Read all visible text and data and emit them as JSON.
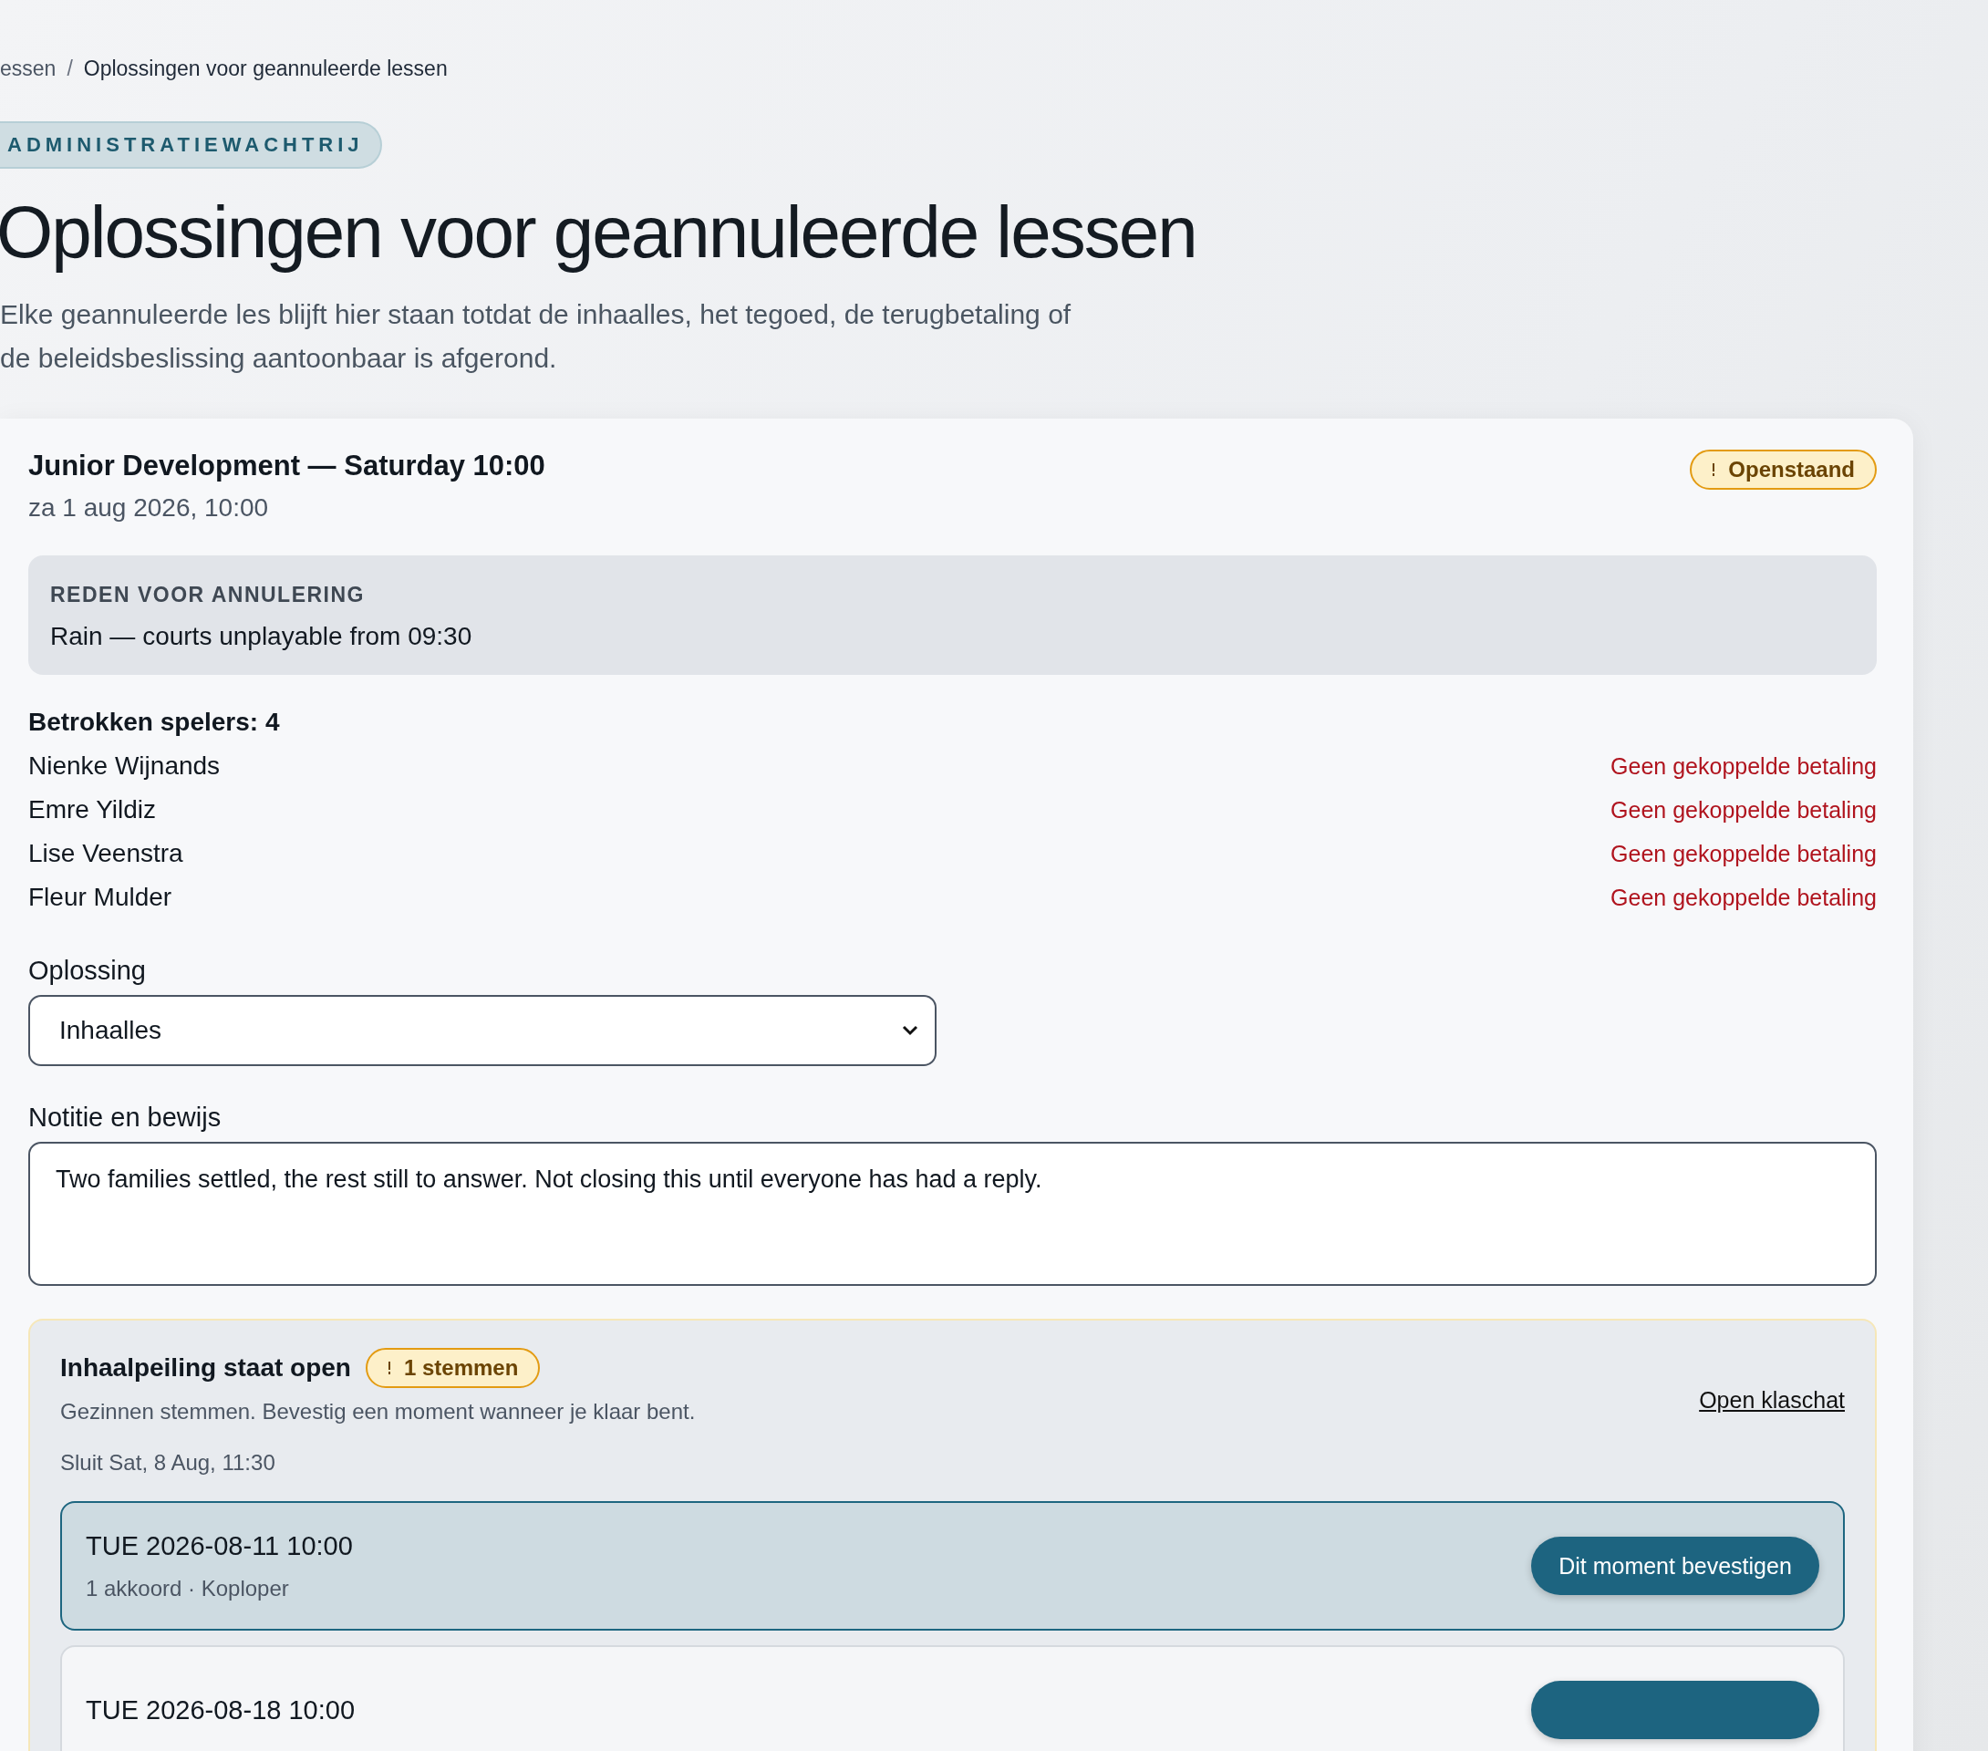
{
  "breadcrumb": {
    "parent": "essen",
    "separator": "/",
    "current": "Oplossingen voor geannuleerde lessen"
  },
  "eyebrow": "ADMINISTRATIEWACHTRIJ",
  "title": "Oplossingen voor geannuleerde lessen",
  "description": [
    "Elke geannuleerde les blijft hier staan totdat de inhaalles, het tegoed, de terugbetaling of",
    "de beleidsbeslissing aantoonbaar is afgerond."
  ],
  "lesson": {
    "title": "Junior Development — Saturday 10:00",
    "date": "za 1 aug 2026, 10:00",
    "status": {
      "label": "Openstaand",
      "kind": "pending"
    },
    "reason": {
      "label": "REDEN VOOR ANNULERING",
      "text": "Rain — courts unplayable from 09:30"
    },
    "players_label": "Betrokken spelers: 4",
    "players": [
      {
        "name": "Nienke Wijnands",
        "payment": "Geen gekoppelde betaling"
      },
      {
        "name": "Emre Yildiz",
        "payment": "Geen gekoppelde betaling"
      },
      {
        "name": "Lise Veenstra",
        "payment": "Geen gekoppelde betaling"
      },
      {
        "name": "Fleur Mulder",
        "payment": "Geen gekoppelde betaling"
      }
    ],
    "resolution": {
      "label": "Oplossing",
      "value": "Inhaalles"
    },
    "note": {
      "label": "Notitie en bewijs",
      "value": "Two families settled, the rest still to answer. Not closing this until everyone has had a reply."
    },
    "poll": {
      "title": "Inhaalpeiling staat open",
      "votes_badge": "1 stemmen",
      "subtitle": "Gezinnen stemmen. Bevestig een moment wanneer je klaar bent.",
      "link": "Open klaschat",
      "closes": "Sluit Sat, 8 Aug, 11:30",
      "options": [
        {
          "slot": "TUE 2026-08-11 10:00",
          "detail": "1 akkoord · Koploper",
          "button": "Dit moment bevestigen",
          "selected": true
        },
        {
          "slot": "TUE 2026-08-18 10:00",
          "selected": false
        }
      ]
    }
  }
}
